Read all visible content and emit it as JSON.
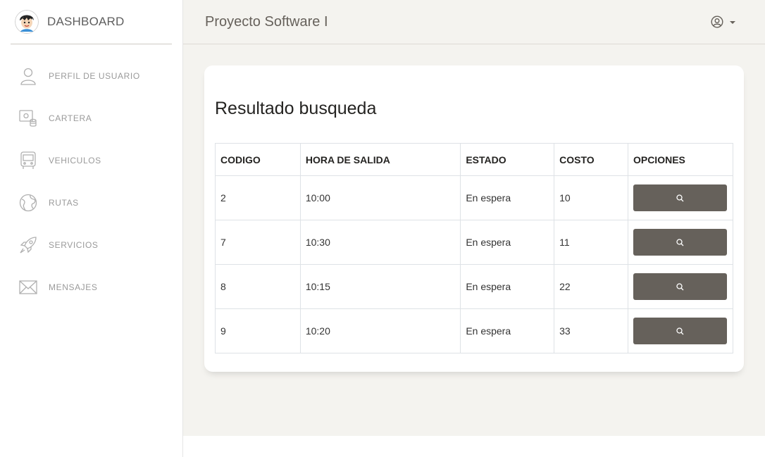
{
  "brand": {
    "title": "DASHBOARD"
  },
  "sidebar": {
    "items": [
      {
        "label": "PERFIL DE USUARIO",
        "icon": "user-icon"
      },
      {
        "label": "CARTERA",
        "icon": "wallet-icon"
      },
      {
        "label": "VEHICULOS",
        "icon": "bus-icon"
      },
      {
        "label": "RUTAS",
        "icon": "globe-icon"
      },
      {
        "label": "SERVICIOS",
        "icon": "rocket-icon"
      },
      {
        "label": "MENSAJES",
        "icon": "envelope-icon"
      }
    ]
  },
  "header": {
    "title": "Proyecto Software I",
    "user_icon": "user-circle-icon"
  },
  "card": {
    "title": "Resultado busqueda",
    "columns": [
      "CODIGO",
      "HORA DE SALIDA",
      "ESTADO",
      "COSTO",
      "OPCIONES"
    ],
    "rows": [
      {
        "codigo": "2",
        "hora": "10:00",
        "estado": "En espera",
        "costo": "10"
      },
      {
        "codigo": "7",
        "hora": "10:30",
        "estado": "En espera",
        "costo": "11"
      },
      {
        "codigo": "8",
        "hora": "10:15",
        "estado": "En espera",
        "costo": "22"
      },
      {
        "codigo": "9",
        "hora": "10:20",
        "estado": "En espera",
        "costo": "33"
      }
    ],
    "action_icon": "search-icon"
  },
  "colors": {
    "sidebar_bg": "#ffffff",
    "main_bg": "#f4f3ef",
    "button": "#66615b",
    "text_muted": "#9a9a9a"
  }
}
